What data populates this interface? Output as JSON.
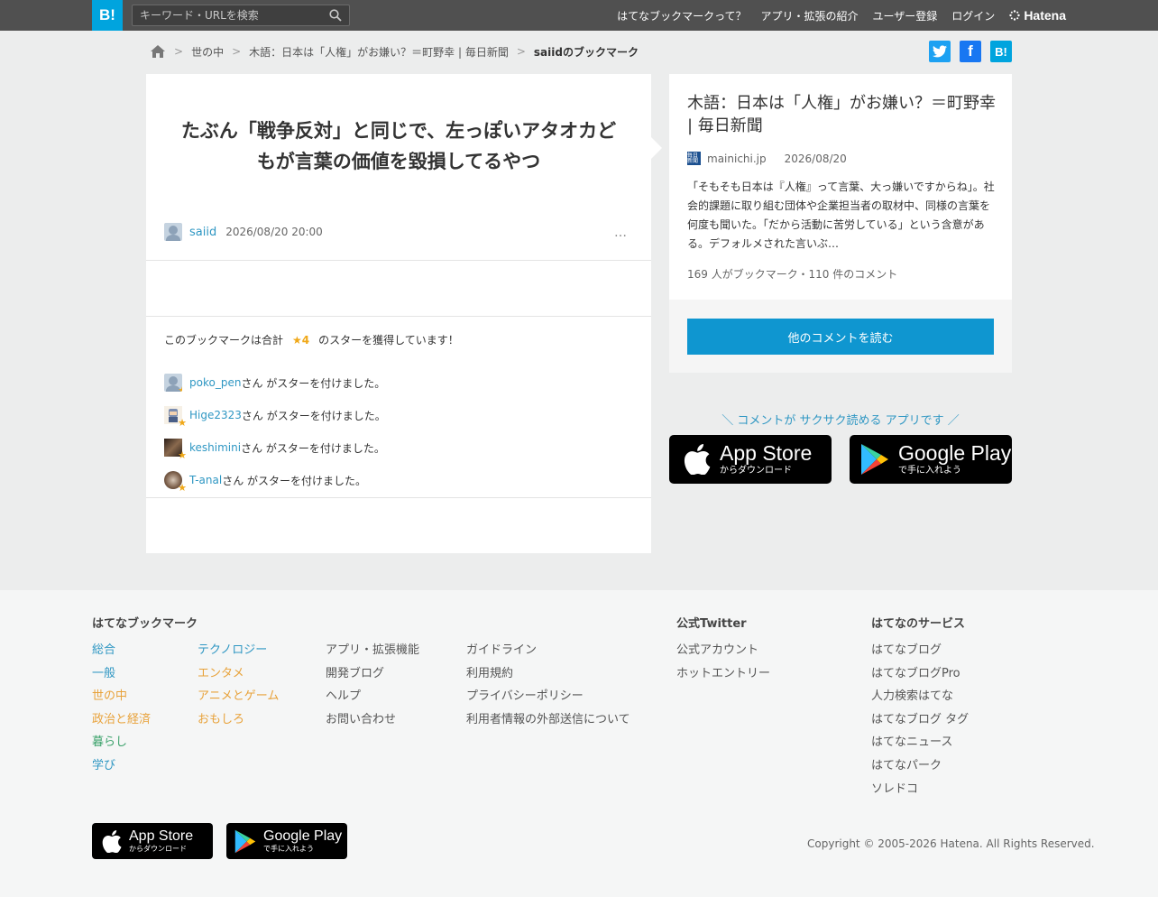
{
  "header": {
    "logo": "B!",
    "search_placeholder": "キーワード・URLを検索",
    "nav": [
      "はてなブックマークって？",
      "アプリ・拡張の紹介",
      "ユーザー登録",
      "ログイン"
    ],
    "hatena_logo": "Hatena"
  },
  "breadcrumb": {
    "items": [
      "世の中",
      "木語：日本は「人権」がお嫌い？＝町野幸 | 毎日新聞"
    ],
    "current": "saiidのブックマーク"
  },
  "share": {
    "twitter": "t",
    "facebook": "f",
    "hatena": "B!"
  },
  "bookmark": {
    "comment": "たぶん「戦争反対」と同じで、左っぽいアタオカどもが言葉の価値を毀損してるやつ",
    "user": "saiid",
    "datetime": "2026/08/20 20:00",
    "more": "…"
  },
  "stars": {
    "prefix": "このブックマークは合計",
    "count": "★4",
    "suffix": "のスターを獲得しています！",
    "action_suffix": "さん がスターを付けました。",
    "users": [
      "poko_pen",
      "Hige2323",
      "keshimini",
      "T-anal"
    ]
  },
  "entry": {
    "title": "木語：日本は「人権」がお嫌い？＝町野幸 | 毎日新聞",
    "favicon_text": "毎日新聞",
    "domain": "mainichi.jp",
    "date": "2026/08/20",
    "description": "「そもそも日本は『人権』って言葉、大っ嫌いですからね」。社会的課題に取り組む団体や企業担当者の取材中、同様の言葉を何度も聞いた。「だから活動に苦労している」という含意がある。デフォルメされた言いぶ…",
    "stats": "169 人がブックマーク・110 件のコメント",
    "read_button": "他のコメントを読む"
  },
  "app_promo": "＼ コメントが サクサク読める アプリです ／",
  "badges": {
    "appstore_main": "App Store",
    "appstore_sub": "からダウンロード",
    "googleplay_main": "Google Play",
    "googleplay_sub": "で手に入れよう"
  },
  "footer": {
    "bookmark_head": "はてなブックマーク",
    "col1": [
      "総合",
      "一般",
      "世の中",
      "政治と経済",
      "暮らし",
      "学び"
    ],
    "col2": [
      "テクノロジー",
      "エンタメ",
      "アニメとゲーム",
      "おもしろ"
    ],
    "col3": [
      "アプリ・拡張機能",
      "開発ブログ",
      "ヘルプ",
      "お問い合わせ"
    ],
    "col4": [
      "ガイドライン",
      "利用規約",
      "プライバシーポリシー",
      "利用者情報の外部送信について"
    ],
    "twitter_head": "公式Twitter",
    "twitter_links": [
      "公式アカウント",
      "ホットエントリー"
    ],
    "services_head": "はてなのサービス",
    "services": [
      "はてなブログ",
      "はてなブログPro",
      "人力検索はてな",
      "はてなブログ タグ",
      "はてなニュース",
      "はてなパーク",
      "ソレドコ"
    ],
    "copyright": "Copyright © 2005-2026 Hatena. All Rights Reserved."
  },
  "colors": {
    "brand": "#00a4de",
    "link": "#2f97c3",
    "star": "#f0a818",
    "button": "#0f96d0"
  }
}
